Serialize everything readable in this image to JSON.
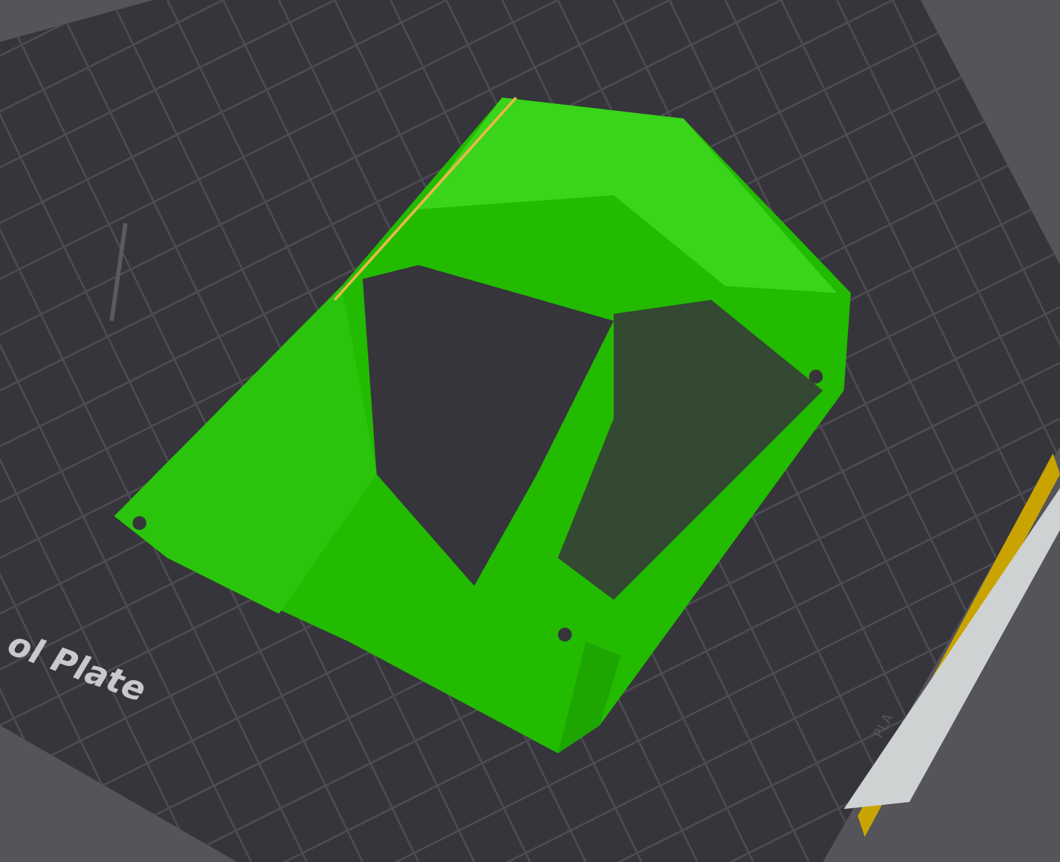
{
  "plate": {
    "label": "ol Plate",
    "material": "PLA"
  }
}
